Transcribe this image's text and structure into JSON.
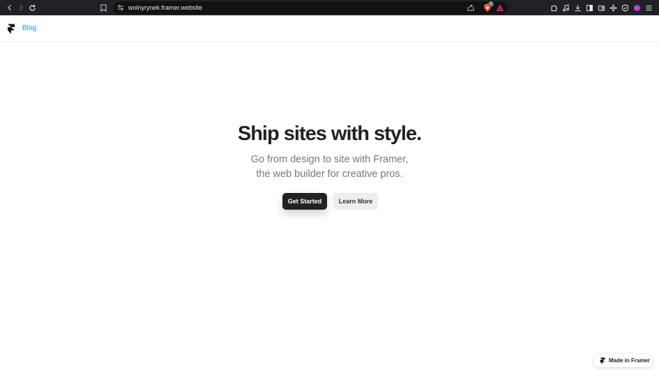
{
  "browser": {
    "url": "wolnyrynek.framer.website",
    "brave_badge": "0",
    "icons": [
      "back-icon",
      "forward-icon",
      "reload-icon",
      "bookmark-icon",
      "site-settings-icon",
      "share-icon",
      "brave-shields-icon",
      "brave-rewards-icon",
      "extensions-icon",
      "media-icon",
      "downloads-icon",
      "sidebar-icon",
      "wallet-icon",
      "leo-icon",
      "vpn-icon",
      "profile-icon",
      "menu-icon"
    ]
  },
  "site": {
    "nav": {
      "blog_label": "Blog"
    },
    "hero": {
      "title": "Ship sites with style.",
      "subtitle_line1": "Go from design to site with Framer,",
      "subtitle_line2": "the web builder for creative pros."
    },
    "buttons": {
      "primary": "Get Started",
      "secondary": "Learn More"
    },
    "badge": "Made in Framer"
  }
}
